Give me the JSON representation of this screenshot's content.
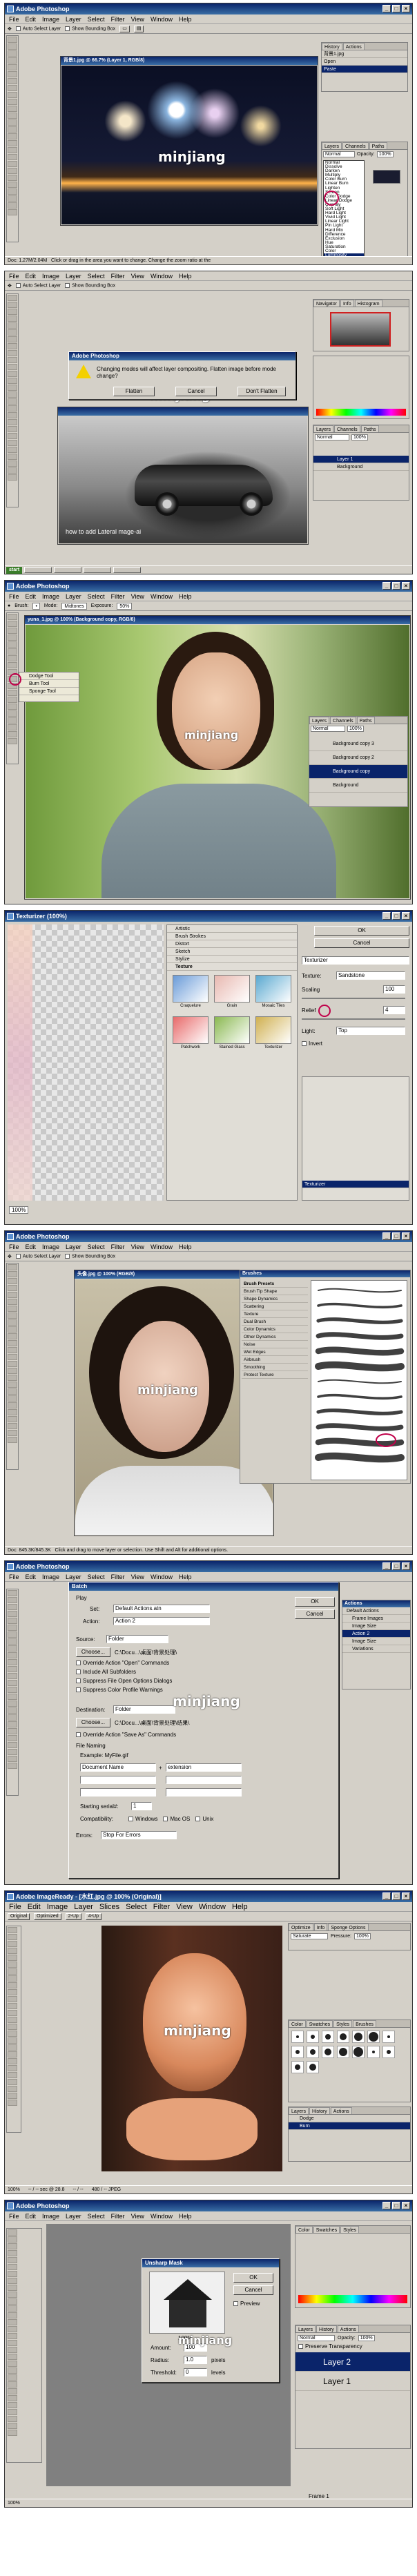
{
  "watermark": "minjiang",
  "ps_menus": [
    "File",
    "Edit",
    "Image",
    "Layer",
    "Select",
    "Filter",
    "View",
    "Window",
    "Help"
  ],
  "ir_menus": [
    "File",
    "Edit",
    "Image",
    "Layer",
    "Slices",
    "Select",
    "Filter",
    "View",
    "Window",
    "Help"
  ],
  "s1": {
    "app_title": "Adobe Photoshop",
    "options": [
      "Auto Select Layer",
      "Show Bounding Box"
    ],
    "doc_title": "背景1.jpg @ 66.7% (Layer 1, RGB/8)",
    "history_tab": "History",
    "actions_tab": "Actions",
    "history_rows": [
      "背景1.jpg",
      "Open",
      "Paste"
    ],
    "layers_tabs": [
      "Layers",
      "Channels",
      "Paths"
    ],
    "blend_mode": "Normal",
    "opacity_label": "Opacity:",
    "opacity_value": "100%",
    "blend_modes": [
      "Normal",
      "Dissolve",
      "Darken",
      "Multiply",
      "Color Burn",
      "Linear Burn",
      "Lighten",
      "Screen",
      "Color Dodge",
      "Linear Dodge",
      "Overlay",
      "Soft Light",
      "Hard Light",
      "Vivid Light",
      "Linear Light",
      "Pin Light",
      "Hard Mix",
      "Difference",
      "Exclusion",
      "Hue",
      "Saturation",
      "Color",
      "Luminosity"
    ],
    "status": "Doc: 1.27M/2.04M",
    "status_hint": "Click or drag in the area you want to change. Change the zoom ratio at the"
  },
  "s2": {
    "options": [
      "Auto Select Layer",
      "Show Bounding Box"
    ],
    "dialog_title": "Adobe Photoshop",
    "dialog_message": "Changing modes will affect layer compositing.  Flatten image before mode change?",
    "btn_flatten": "Flatten",
    "btn_cancel": "Cancel",
    "btn_dont_flatten": "Don't Flatten",
    "navigator_tabs": [
      "Navigator",
      "Info",
      "Histogram"
    ],
    "layers_tabs": [
      "Layers",
      "Channels",
      "Paths"
    ],
    "blend_mode": "Normal",
    "opacity_value": "100%",
    "layer_rows": [
      "Layer 1",
      "Background"
    ],
    "caption": "how to add Lateral mage-ai"
  },
  "s3": {
    "app_title": "Adobe Photoshop",
    "brush_label": "Brush:",
    "mode_label": "Mode:",
    "mode_value": "Midtones",
    "exposure_label": "Exposure:",
    "exposure_value": "50%",
    "doc_title": "yuna_1.jpg @ 100% (Background copy, RGB/8)",
    "tool_flyout": [
      "Dodge Tool",
      "Burn Tool",
      "Sponge Tool"
    ],
    "layers_tabs": [
      "Layers",
      "Channels",
      "Paths"
    ],
    "blend_mode": "Normal",
    "opacity_value": "100%",
    "layer_rows": [
      "Background copy 3",
      "Background copy 2",
      "Background copy",
      "Background"
    ]
  },
  "s4": {
    "app_title": "Texturizer (100%)",
    "filters": [
      "Artistic",
      "Brush Strokes",
      "Distort",
      "Sketch",
      "Stylize",
      "Texture"
    ],
    "texture_thumbs": [
      "Craquelure",
      "Grain",
      "Mosaic Tiles",
      "Patchwork",
      "Stained Glass",
      "Texturizer"
    ],
    "ok": "OK",
    "cancel": "Cancel",
    "filter_select": "Texturizer",
    "texture_label": "Texture:",
    "texture_value": "Sandstone",
    "scaling_label": "Scaling",
    "scaling_value": "100",
    "relief_label": "Relief",
    "relief_value": "4",
    "light_label": "Light:",
    "light_value": "Top",
    "invert_label": "Invert",
    "zoom": "100%",
    "effect_layer": "Texturizer"
  },
  "s5": {
    "app_title": "Adobe Photoshop",
    "options": [
      "Auto Select Layer",
      "Show Bounding Box"
    ],
    "doc_title": "头像.jpg @ 100% (RGB/8)",
    "brushes_title": "Brushes",
    "brush_presets": [
      "Brush Presets",
      "Brush Tip Shape",
      "Shape Dynamics",
      "Scattering",
      "Texture",
      "Dual Brush",
      "Color Dynamics",
      "Other Dynamics",
      "Noise",
      "Wet Edges",
      "Airbrush",
      "Smoothing",
      "Protect Texture"
    ],
    "status": "Doc: 845.3K/845.3K",
    "status_hint": "Click and drag to move layer or selection.  Use Shift and Alt for additional options."
  },
  "s6": {
    "app_title": "Adobe Photoshop",
    "dialog_title": "Batch",
    "play_label": "Play",
    "set_label": "Set:",
    "set_value": "Default Actions.atn",
    "action_label": "Action:",
    "action_value": "Action 2",
    "source_label": "Source:",
    "source_value": "Folder",
    "choose": "Choose...",
    "source_path": "C:\\Docu...\\桌面\\背景处理\\",
    "source_opts": [
      "Override Action \"Open\" Commands",
      "Include All Subfolders",
      "Suppress File Open Options Dialogs",
      "Suppress Color Profile Warnings"
    ],
    "dest_label": "Destination:",
    "dest_value": "Folder",
    "dest_path": "C:\\Docu...\\桌面\\背景处理\\结果\\",
    "override_save": "Override Action \"Save As\" Commands",
    "file_naming": "File Naming",
    "example_label": "Example: MyFile.gif",
    "name_fields": [
      "Document Name",
      "extension"
    ],
    "serial_label": "Starting serial#:",
    "serial_value": "1",
    "compat_label": "Compatibility:",
    "compat_opts": [
      "Windows",
      "Mac OS",
      "Unix"
    ],
    "errors_label": "Errors:",
    "errors_value": "Stop For Errors",
    "ok": "OK",
    "cancel": "Cancel",
    "actions_panel_title": "Actions",
    "actions_rows": [
      "Default Actions",
      "Frame Images",
      "Image Size",
      "Action 2",
      "Image Size",
      "Variations"
    ]
  },
  "s7": {
    "app_title": "Adobe ImageReady - [水红.jpg @ 100% (Original)]",
    "tabs": [
      "Original",
      "Optimized",
      "2-Up",
      "4-Up"
    ],
    "optimize_tabs": [
      "Optimize",
      "Info",
      "Sponge Options"
    ],
    "optimize_mode": "Saturate",
    "pressure_label": "Pressure:",
    "pressure_value": "100%",
    "color_tabs": [
      "Color",
      "Swatches",
      "Styles",
      "Brushes"
    ],
    "history_tabs": [
      "Layers",
      "History",
      "Actions"
    ],
    "history_rows": [
      "Dodge",
      "Burn"
    ],
    "status": [
      "100%",
      "-- / -- sec @ 28.8",
      "-- / --",
      "480 / -- JPEG"
    ]
  },
  "s8": {
    "app_title": "Adobe Photoshop",
    "dialog_title": "Unsharp Mask",
    "ok": "OK",
    "cancel": "Cancel",
    "preview_label": "Preview",
    "zoom": "100%",
    "amount_label": "Amount:",
    "amount_value": "100",
    "radius_label": "Radius:",
    "radius_value": "1.0",
    "pixels": "pixels",
    "threshold_label": "Threshold:",
    "threshold_value": "0",
    "levels": "levels",
    "color_tabs": [
      "Color",
      "Swatches",
      "Styles"
    ],
    "layers_tabs": [
      "Layers",
      "History",
      "Actions"
    ],
    "blend_mode": "Normal",
    "opacity_label": "Opacity:",
    "opacity_value": "100%",
    "preserve": "Preserve Transparency",
    "layer_rows": [
      "Layer 2",
      "Layer 1"
    ],
    "frame": "Frame 1",
    "status": "100%"
  }
}
